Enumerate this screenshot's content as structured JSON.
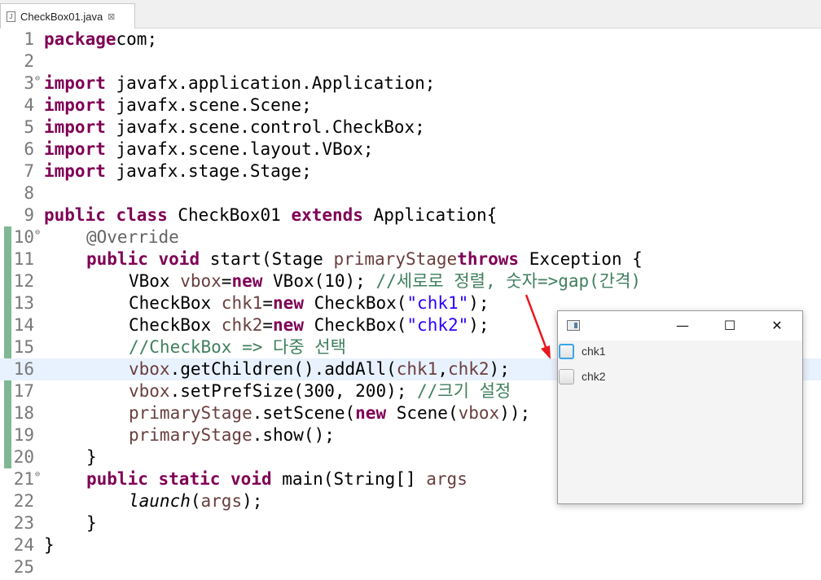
{
  "tab": {
    "title": "CheckBox01.java",
    "close": "⊠",
    "icon": "java-file-icon"
  },
  "editor": {
    "lines": [
      {
        "n": "1",
        "tokens": [
          [
            "kw",
            "package"
          ],
          [
            "",
            "com;"
          ]
        ]
      },
      {
        "n": "2",
        "tokens": []
      },
      {
        "n": "3",
        "fold": "⊖",
        "tokens": [
          [
            "kw",
            "import"
          ],
          [
            "",
            " javafx.application.Application;"
          ]
        ]
      },
      {
        "n": "4",
        "tokens": [
          [
            "kw",
            "import"
          ],
          [
            "",
            " javafx.scene.Scene;"
          ]
        ]
      },
      {
        "n": "5",
        "tokens": [
          [
            "kw",
            "import"
          ],
          [
            "",
            " javafx.scene.control.CheckBox;"
          ]
        ]
      },
      {
        "n": "6",
        "tokens": [
          [
            "kw",
            "import"
          ],
          [
            "",
            " javafx.scene.layout.VBox;"
          ]
        ]
      },
      {
        "n": "7",
        "tokens": [
          [
            "kw",
            "import"
          ],
          [
            "",
            " javafx.stage.Stage;"
          ]
        ]
      },
      {
        "n": "8",
        "tokens": []
      },
      {
        "n": "9",
        "tokens": [
          [
            "kw",
            "public"
          ],
          [
            "",
            " "
          ],
          [
            "kw",
            "class"
          ],
          [
            "",
            " CheckBox01 "
          ],
          [
            "kw",
            "extends"
          ],
          [
            "",
            " Application{"
          ]
        ]
      },
      {
        "n": "10",
        "fold": "⊖",
        "tokens": [
          [
            "",
            " "
          ],
          [
            "ann",
            "@Override"
          ]
        ]
      },
      {
        "n": "11",
        "tokens": [
          [
            "",
            " "
          ],
          [
            "kw",
            "public"
          ],
          [
            "",
            " "
          ],
          [
            "kw",
            "void"
          ],
          [
            "",
            " start(Stage "
          ],
          [
            "var",
            "primaryStage"
          ],
          [
            ") "
          ],
          [
            "kw",
            "throws"
          ],
          [
            "",
            " Exception {"
          ]
        ]
      },
      {
        "n": "12",
        "tokens": [
          [
            "",
            " VBox "
          ],
          [
            "var",
            "vbox"
          ],
          [
            "",
            "="
          ],
          [
            "kw",
            "new"
          ],
          [
            "",
            " VBox(10); "
          ],
          [
            "cm",
            "//세로로 정렬, 숫자=>gap(간격)"
          ]
        ]
      },
      {
        "n": "13",
        "tokens": [
          [
            "",
            " CheckBox "
          ],
          [
            "var",
            "chk1"
          ],
          [
            "",
            "="
          ],
          [
            "kw",
            "new"
          ],
          [
            "",
            " CheckBox("
          ],
          [
            "str",
            "\"chk1\""
          ],
          [
            "",
            ");"
          ]
        ]
      },
      {
        "n": "14",
        "tokens": [
          [
            "",
            " CheckBox "
          ],
          [
            "var",
            "chk2"
          ],
          [
            "",
            "="
          ],
          [
            "kw",
            "new"
          ],
          [
            "",
            " CheckBox("
          ],
          [
            "str",
            "\"chk2\""
          ],
          [
            "",
            ");"
          ]
        ]
      },
      {
        "n": "15",
        "tokens": [
          [
            "",
            " "
          ],
          [
            "cm",
            "//CheckBox => 다중 선택"
          ]
        ]
      },
      {
        "n": "16",
        "current": true,
        "tokens": [
          [
            "",
            " "
          ],
          [
            "var",
            "vbox"
          ],
          [
            "",
            ".getChildren().addAll("
          ],
          [
            "var",
            "chk1"
          ],
          [
            "",
            ","
          ],
          [
            "var",
            "chk2"
          ],
          [
            "",
            ");"
          ]
        ]
      },
      {
        "n": "17",
        "tokens": [
          [
            "",
            " "
          ],
          [
            "var",
            "vbox"
          ],
          [
            "",
            ".setPrefSize(300, 200); "
          ],
          [
            "cm",
            "//크기 설정"
          ]
        ]
      },
      {
        "n": "18",
        "tokens": [
          [
            "",
            " "
          ],
          [
            "var",
            "primaryStage"
          ],
          [
            "",
            ".setScene("
          ],
          [
            "kw",
            "new"
          ],
          [
            "",
            " Scene("
          ],
          [
            "var",
            "vbox"
          ],
          [
            "",
            "));"
          ]
        ]
      },
      {
        "n": "19",
        "tokens": [
          [
            "",
            " "
          ],
          [
            "var",
            "primaryStage"
          ],
          [
            "",
            ".show();"
          ]
        ]
      },
      {
        "n": "20",
        "tokens": [
          [
            "",
            " }"
          ]
        ]
      },
      {
        "n": "21",
        "fold": "⊖",
        "tokens": [
          [
            "",
            " "
          ],
          [
            "kw",
            "public"
          ],
          [
            "",
            " "
          ],
          [
            "kw",
            "static"
          ],
          [
            "",
            " "
          ],
          [
            "kw",
            "void"
          ],
          [
            "",
            " main(String[] "
          ],
          [
            "var",
            "args"
          ],
          [
            ") {"
          ]
        ]
      },
      {
        "n": "22",
        "tokens": [
          [
            "",
            " "
          ],
          [
            "stat",
            "launch"
          ],
          [
            "",
            "("
          ],
          [
            "var",
            "args"
          ],
          [
            "",
            ");"
          ]
        ]
      },
      {
        "n": "23",
        "tokens": [
          [
            "",
            " }"
          ]
        ]
      },
      {
        "n": "24",
        "tokens": [
          [
            "",
            "}"
          ]
        ]
      },
      {
        "n": "25",
        "tokens": []
      }
    ]
  },
  "fx_window": {
    "minimize": "—",
    "maximize": "☐",
    "close": "✕",
    "checkboxes": [
      {
        "label": "chk1",
        "checked": false,
        "focused": true
      },
      {
        "label": "chk2",
        "checked": false,
        "focused": false
      }
    ]
  },
  "colors": {
    "keyword": "#7f0055",
    "string": "#2a00ff",
    "comment": "#3f7f5f",
    "annotation": "#646464",
    "variable": "#6a3e3e",
    "arrow": "#e8191f"
  }
}
